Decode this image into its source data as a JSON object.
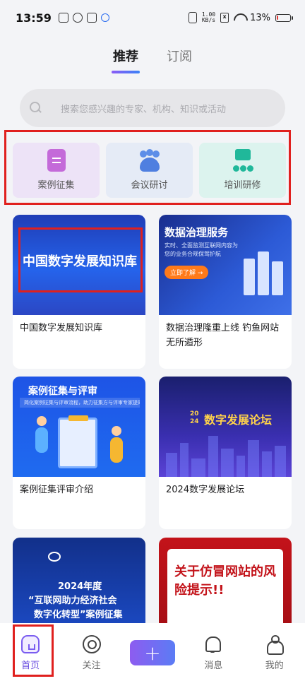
{
  "status_bar": {
    "time": "13:59",
    "net_speed_value": "1.00",
    "net_speed_unit": "KB/s",
    "battery": "13%",
    "battery_level": 0.13
  },
  "tabs": [
    {
      "label": "推荐",
      "active": true
    },
    {
      "label": "订阅",
      "active": false
    }
  ],
  "search": {
    "placeholder": "搜索您感兴趣的专家、机构、知识或活动"
  },
  "categories": [
    {
      "label": "案例征集",
      "icon": "document-icon"
    },
    {
      "label": "会议研讨",
      "icon": "meeting-icon"
    },
    {
      "label": "培训研修",
      "icon": "training-icon"
    }
  ],
  "cards": [
    {
      "title": "中国数字发展知识库",
      "image_text": "中国数字发展知识库"
    },
    {
      "title": "数据治理隆重上线 钓鱼网站无所遁形",
      "image_text": "数据治理服务",
      "image_subtext": "实时、全面监测互联网内容为您的业务合规保驾护航",
      "image_button": "立即了解 →"
    },
    {
      "title": "案例征集评审介绍",
      "image_text": "案例征集与评审",
      "image_subtext": "简化案例征集与评审流程，助力征集方与评审专家提效"
    },
    {
      "title": "2024数字发展论坛",
      "image_text": "数字发展论坛",
      "image_year": "2024"
    },
    {
      "title": "",
      "image_text_1": "2024年度",
      "image_text_2": "“互联网助力经济社会",
      "image_text_3": "数字化转型”案例征集"
    },
    {
      "title": "",
      "image_text": "关于仿冒网站的风险提示!!"
    }
  ],
  "bottom_nav": [
    {
      "label": "首页",
      "icon": "home-icon",
      "active": true
    },
    {
      "label": "关注",
      "icon": "follow-icon",
      "active": false
    },
    {
      "label": "",
      "icon": "plus-icon",
      "active": false,
      "glyph": "+"
    },
    {
      "label": "消息",
      "icon": "bell-icon",
      "active": false
    },
    {
      "label": "我的",
      "icon": "profile-icon",
      "active": false
    }
  ],
  "colors": {
    "accent": "#6b4fe0",
    "highlight": "#e0201e"
  }
}
